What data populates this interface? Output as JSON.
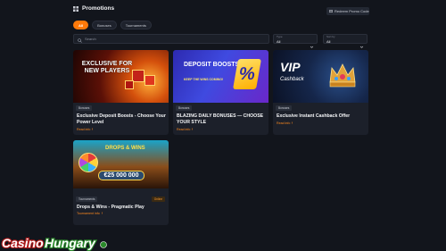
{
  "page": {
    "title": "Promotions",
    "redeem_button": "Redeem Promo Code"
  },
  "filters": {
    "chips": [
      {
        "label": "All",
        "active": true
      },
      {
        "label": "Bonuses",
        "active": false
      },
      {
        "label": "Tournaments",
        "active": false
      }
    ]
  },
  "search": {
    "placeholder": "Search",
    "value": ""
  },
  "selects": {
    "type": {
      "label": "Type",
      "value": "All"
    },
    "sort": {
      "label": "Sort by",
      "value": "All"
    }
  },
  "cards": [
    {
      "tag": "Bonuses",
      "title": "Exclusive Deposit Boosts - Choose Your Power Level",
      "more": "Read info",
      "banner_text": "EXCLUSIVE FOR NEW PLAYERS"
    },
    {
      "tag": "Bonuses",
      "title": "BLAZING DAILY BONUSES — CHOOSE YOUR STYLE",
      "more": "Read info",
      "banner_text": "DEPOSIT BOOSTS",
      "banner_sub": "KEEP THE WINS COMING!",
      "banner_symbol": "%"
    },
    {
      "tag": "Bonuses",
      "title": "Exclusive Instant Cashback Offer",
      "more": "Read info",
      "banner_text": "VIP",
      "banner_sub": "Cashback"
    },
    {
      "tag": "Tournaments",
      "status": "Online",
      "title": "Drops & Wins - Pragmatic Play",
      "more": "Tournament info",
      "banner_text": "DROPS & WINS",
      "banner_amount": "€25 000 000"
    }
  ],
  "watermark": {
    "text": "CasinoHungary.com"
  },
  "colors": {
    "background": "#12151c",
    "card": "#1c202a",
    "accent": "#ff7a0a"
  }
}
